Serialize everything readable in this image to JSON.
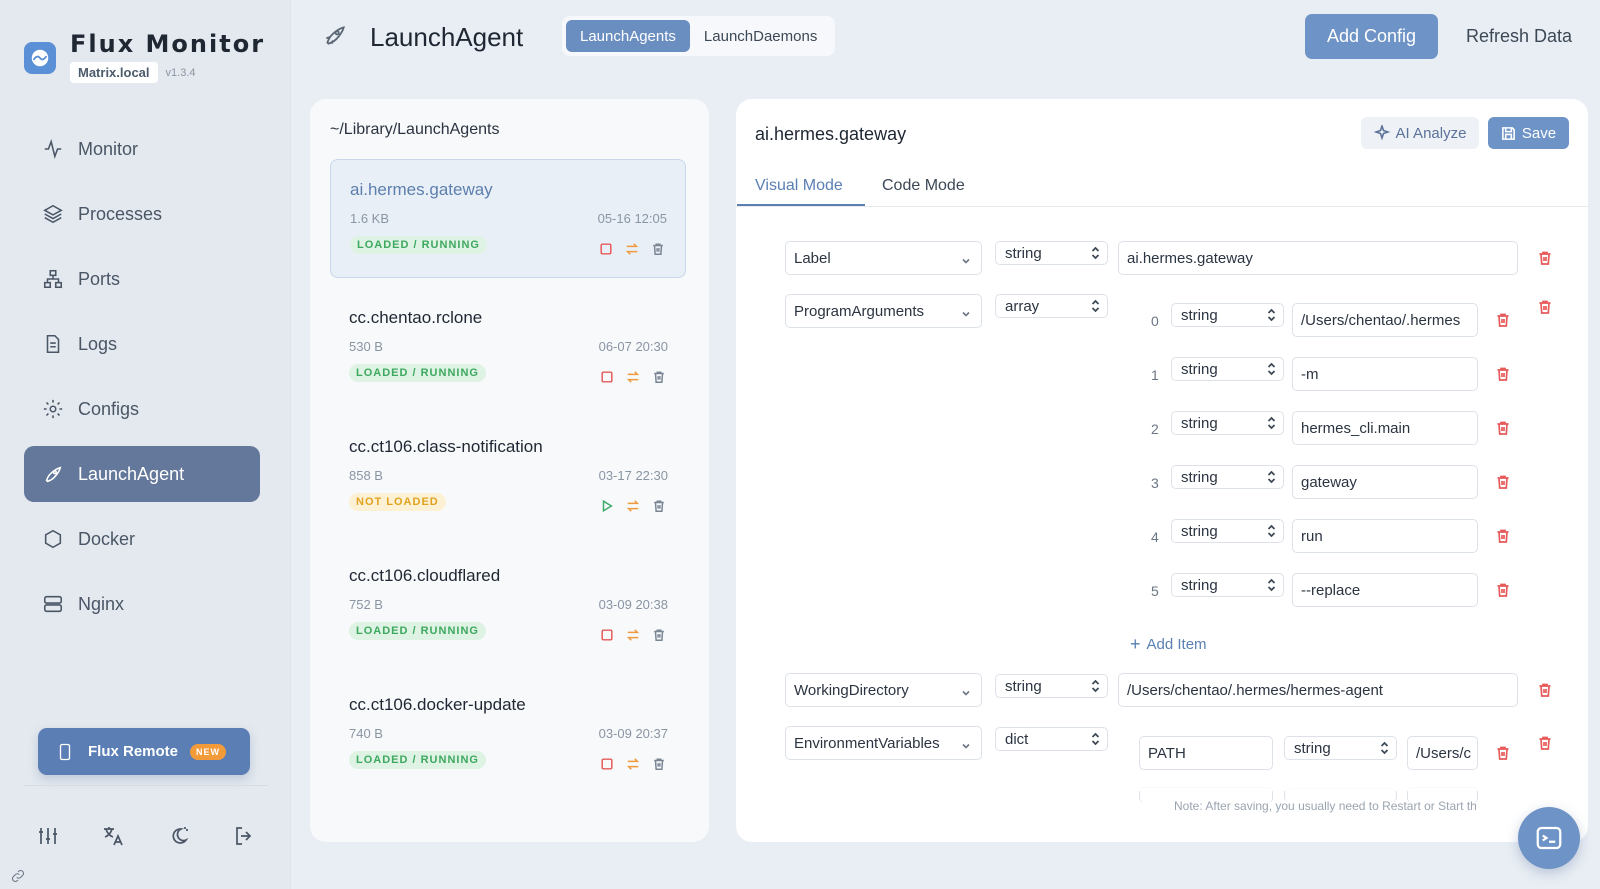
{
  "brand": {
    "name": "Flux Monitor",
    "host": "Matrix.local",
    "version": "v1.3.4"
  },
  "nav": [
    {
      "label": "Monitor",
      "icon": "activity-icon"
    },
    {
      "label": "Processes",
      "icon": "layers-icon"
    },
    {
      "label": "Ports",
      "icon": "network-icon"
    },
    {
      "label": "Logs",
      "icon": "file-icon"
    },
    {
      "label": "Configs",
      "icon": "gear-icon"
    },
    {
      "label": "LaunchAgent",
      "icon": "rocket-icon",
      "active": true
    },
    {
      "label": "Docker",
      "icon": "hexagon-icon"
    },
    {
      "label": "Nginx",
      "icon": "server-icon"
    }
  ],
  "remote": {
    "label": "Flux Remote",
    "badge": "NEW"
  },
  "header": {
    "title": "LaunchAgent",
    "tabs": [
      "LaunchAgents",
      "LaunchDaemons"
    ],
    "add_config": "Add Config",
    "refresh": "Refresh Data"
  },
  "list": {
    "path": "~/Library/LaunchAgents",
    "items": [
      {
        "name": "ai.hermes.gateway",
        "size": "1.6 KB",
        "date": "05-16 12:05",
        "status": "LOADED / RUNNING"
      },
      {
        "name": "cc.chentao.rclone",
        "size": "530 B",
        "date": "06-07 20:30",
        "status": "LOADED / RUNNING"
      },
      {
        "name": "cc.ct106.class-notification",
        "size": "858 B",
        "date": "03-17 22:30",
        "status": "NOT LOADED"
      },
      {
        "name": "cc.ct106.cloudflared",
        "size": "752 B",
        "date": "03-09 20:38",
        "status": "LOADED / RUNNING"
      },
      {
        "name": "cc.ct106.docker-update",
        "size": "740 B",
        "date": "03-09 20:37",
        "status": "LOADED / RUNNING"
      }
    ]
  },
  "editor": {
    "title": "ai.hermes.gateway",
    "ai_analyze": "AI Analyze",
    "save": "Save",
    "tabs": [
      "Visual Mode",
      "Code Mode"
    ],
    "rows": {
      "label": {
        "key": "Label",
        "type": "string",
        "value": "ai.hermes.gateway"
      },
      "args": {
        "key": "ProgramArguments",
        "type": "array"
      },
      "workdir": {
        "key": "WorkingDirectory",
        "type": "string",
        "value": "/Users/chentao/.hermes/hermes-agent"
      },
      "env": {
        "key": "EnvironmentVariables",
        "type": "dict",
        "env_key": "PATH",
        "env_type": "string",
        "env_value": "/Users/c"
      }
    },
    "args": [
      {
        "index": "0",
        "type": "string",
        "value": "/Users/chentao/.hermes"
      },
      {
        "index": "1",
        "type": "string",
        "value": "-m"
      },
      {
        "index": "2",
        "type": "string",
        "value": "hermes_cli.main"
      },
      {
        "index": "3",
        "type": "string",
        "value": "gateway"
      },
      {
        "index": "4",
        "type": "string",
        "value": "run"
      },
      {
        "index": "5",
        "type": "string",
        "value": "--replace"
      }
    ],
    "add_item": "Add Item",
    "note": "Note: After saving, you usually need to Restart or Start th"
  },
  "colors": {
    "accent": "#6e93c6",
    "running": "#3da85f",
    "not_loaded": "#e0a21f",
    "danger": "#e65a5a"
  }
}
